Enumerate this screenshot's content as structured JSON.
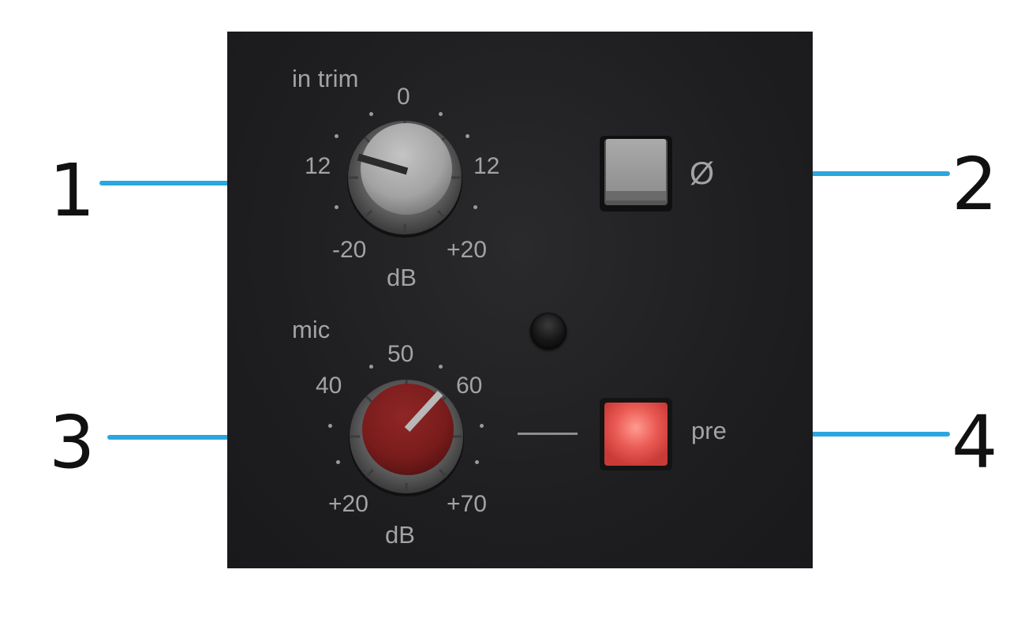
{
  "callouts": [
    "1",
    "2",
    "3",
    "4"
  ],
  "in_trim": {
    "title": "in trim",
    "ticks": {
      "top": "0",
      "left": "12",
      "right": "12",
      "bottom_left": "-20",
      "bottom_right": "+20"
    },
    "unit": "dB"
  },
  "phase": {
    "symbol": "Ø"
  },
  "mic": {
    "title": "mic",
    "ticks": {
      "top": "50",
      "upper_left": "40",
      "upper_right": "60",
      "bottom_left": "+20",
      "bottom_right": "+70"
    },
    "unit": "dB"
  },
  "pre": {
    "label": "pre"
  },
  "colors": {
    "callout_line": "#2ba6df",
    "mic_knob": "#7a1c1c",
    "pre_button": "#e9605c",
    "panel": "#1f1f21"
  }
}
